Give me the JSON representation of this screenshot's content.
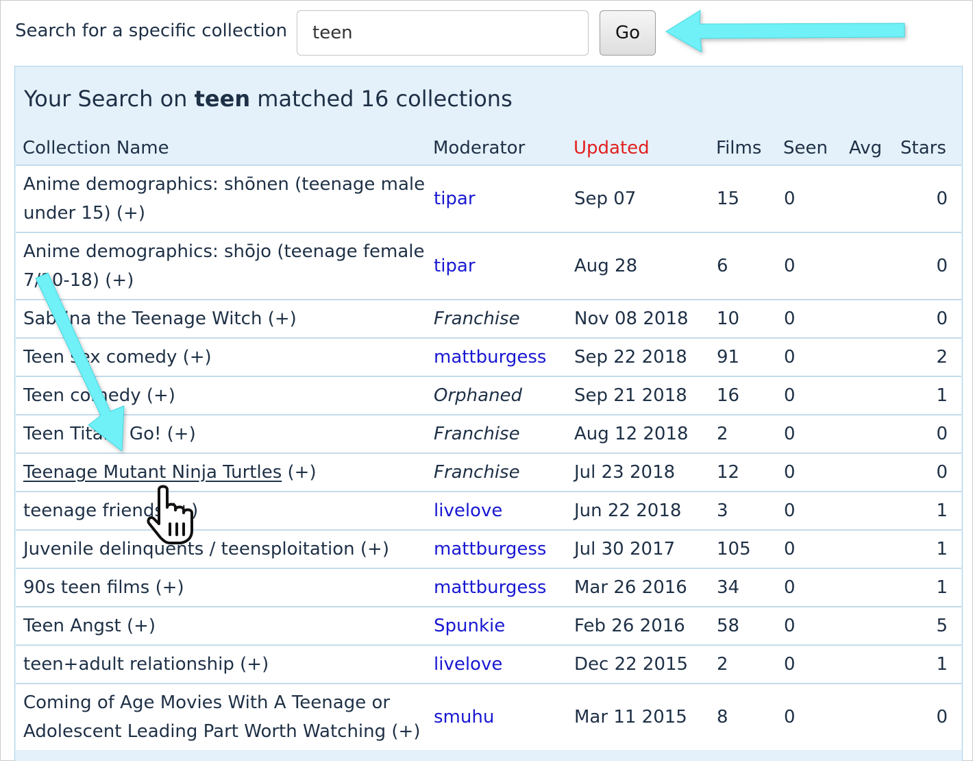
{
  "search": {
    "label": "Search for a specific collection",
    "value": "teen",
    "button_label": "Go"
  },
  "results": {
    "title_prefix": "Your Search on ",
    "query": "teen",
    "title_suffix": " matched 16 collections",
    "columns": {
      "name": "Collection Name",
      "moderator": "Moderator",
      "updated": "Updated",
      "films": "Films",
      "seen": "Seen",
      "avg": "Avg",
      "stars": "Stars"
    },
    "rows": [
      {
        "name": "Anime demographics: shōnen (teenage male under 15) (+)",
        "moderator": "tipar",
        "mod_style": "link",
        "updated": "Sep 07",
        "films": "15",
        "seen": "0",
        "stars": "0"
      },
      {
        "name": "Anime demographics: shōjo (teenage female 7/10-18) (+)",
        "moderator": "tipar",
        "mod_style": "link",
        "updated": "Aug 28",
        "films": "6",
        "seen": "0",
        "stars": "0"
      },
      {
        "name": "Sabrina the Teenage Witch (+)",
        "moderator": "Franchise",
        "mod_style": "ital",
        "updated": "Nov 08 2018",
        "films": "10",
        "seen": "0",
        "stars": "0"
      },
      {
        "name": "Teen sex comedy (+)",
        "moderator": "mattburgess",
        "mod_style": "link",
        "updated": "Sep 22 2018",
        "films": "91",
        "seen": "0",
        "stars": "2"
      },
      {
        "name": "Teen comedy (+)",
        "moderator": "Orphaned",
        "mod_style": "ital",
        "updated": "Sep 21 2018",
        "films": "16",
        "seen": "0",
        "stars": "1"
      },
      {
        "name": "Teen Titans Go! (+)",
        "moderator": "Franchise",
        "mod_style": "ital",
        "updated": "Aug 12 2018",
        "films": "2",
        "seen": "0",
        "stars": "0"
      },
      {
        "name": "Teenage Mutant Ninja Turtles",
        "name_suffix": " (+)",
        "hovered": true,
        "moderator": "Franchise",
        "mod_style": "ital",
        "updated": "Jul 23 2018",
        "films": "12",
        "seen": "0",
        "stars": "0"
      },
      {
        "name": "teenage friends (+)",
        "moderator": "livelove",
        "mod_style": "link",
        "updated": "Jun 22 2018",
        "films": "3",
        "seen": "0",
        "stars": "1"
      },
      {
        "name": "Juvenile delinquents / teensploitation (+)",
        "moderator": "mattburgess",
        "mod_style": "link",
        "updated": "Jul 30 2017",
        "films": "105",
        "seen": "0",
        "stars": "1"
      },
      {
        "name": "90s teen films (+)",
        "moderator": "mattburgess",
        "mod_style": "link",
        "updated": "Mar 26 2016",
        "films": "34",
        "seen": "0",
        "stars": "1"
      },
      {
        "name": "Teen Angst (+)",
        "moderator": "Spunkie",
        "mod_style": "link",
        "updated": "Feb 26 2016",
        "films": "58",
        "seen": "0",
        "stars": "5"
      },
      {
        "name": "teen+adult relationship (+)",
        "moderator": "livelove",
        "mod_style": "link",
        "updated": "Dec 22 2015",
        "films": "2",
        "seen": "0",
        "stars": "1"
      },
      {
        "name": "Coming of Age Movies With A Teenage or Adolescent Leading Part Worth Watching (+)",
        "moderator": "smuhu",
        "mod_style": "link",
        "updated": "Mar 11 2015",
        "films": "8",
        "seen": "0",
        "stars": "0"
      }
    ]
  },
  "annotations": {
    "arrow_color": "#6ff0f7",
    "cursor": "hand-pointer-icon"
  }
}
